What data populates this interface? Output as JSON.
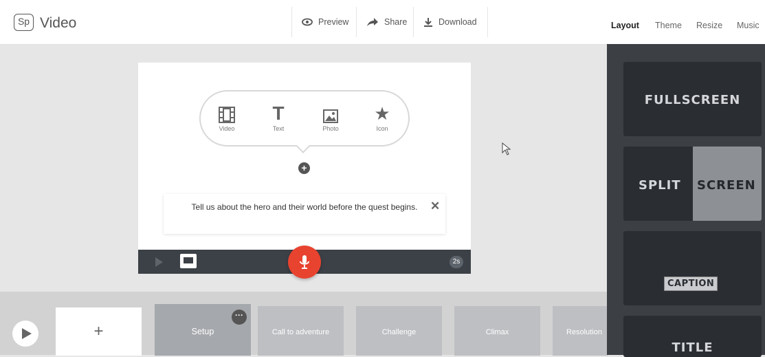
{
  "app": {
    "logo": "Sp",
    "title": "Video"
  },
  "toolbar": {
    "preview": "Preview",
    "share": "Share",
    "download": "Download"
  },
  "right_nav": [
    {
      "label": "Layout",
      "active": true
    },
    {
      "label": "Theme",
      "active": false
    },
    {
      "label": "Resize",
      "active": false
    },
    {
      "label": "Music",
      "active": false
    }
  ],
  "add_content": {
    "video": "Video",
    "text": "Text",
    "photo": "Photo",
    "icon": "Icon",
    "text_glyph": "T",
    "icon_glyph": "★",
    "add_glyph": "+"
  },
  "prompt": {
    "text": "Tell us about the hero and their world before the quest begins.",
    "close": "✕"
  },
  "controls": {
    "duration": "2s"
  },
  "filmstrip": {
    "add_label": "+",
    "menu_label": "···",
    "slides": [
      {
        "label": "Setup",
        "active": true
      },
      {
        "label": "Call to adventure",
        "active": false
      },
      {
        "label": "Challenge",
        "active": false
      },
      {
        "label": "Climax",
        "active": false
      },
      {
        "label": "Resolution",
        "active": false
      }
    ]
  },
  "layouts": {
    "fullscreen": "FULLSCREEN",
    "split": "SPLIT",
    "screen": "SCREEN",
    "caption": "CAPTION",
    "title": "TITLE"
  },
  "icons": [
    "eye-icon",
    "share-arrow-icon",
    "download-icon",
    "film-icon",
    "text-icon",
    "photo-icon",
    "star-icon",
    "plus-circle-icon",
    "close-icon",
    "play-icon",
    "caption-icon",
    "microphone-icon",
    "cursor-icon"
  ],
  "colors": {
    "mic": "#e8432f",
    "panel": "#3c4045",
    "card": "#2a2e33",
    "slide": "#bdbfc2"
  }
}
